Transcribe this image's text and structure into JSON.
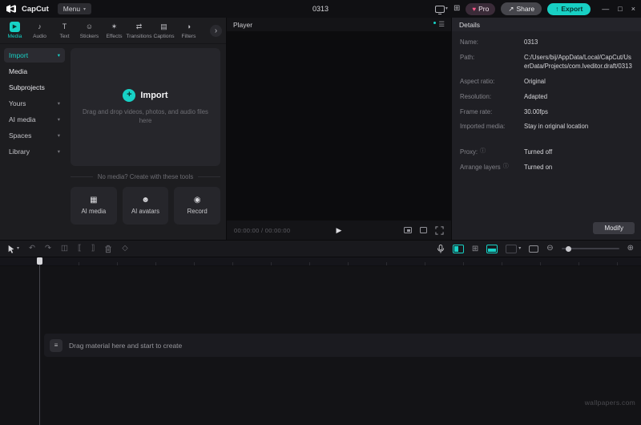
{
  "colors": {
    "accent": "#17d1c5",
    "pro_heart": "#ff5a8c",
    "export_bg": "#18d0c4"
  },
  "titlebar": {
    "app_name": "CapCut",
    "menu_label": "Menu",
    "document_title": "0313",
    "pro_label": "Pro",
    "share_label": "Share",
    "export_label": "Export"
  },
  "icons": {
    "caret_down": "▾",
    "chevron_more": "›",
    "minimize": "—",
    "maximize": "□",
    "close": "×",
    "share_arrow": "↗",
    "export_arrow": "↑",
    "heart": "♥",
    "layout_grid": "⊞",
    "tab_media": "▶",
    "tab_audio": "♪",
    "tab_text": "T",
    "tab_stickers": "☺",
    "tab_effects": "✶",
    "tab_transitions": "⇄",
    "tab_captions": "▤",
    "tab_filters": "◑",
    "plus": "+",
    "tool_ai_media": "▦",
    "tool_ai_avatars": "☻",
    "tool_record": "◉",
    "player_menu": "☰",
    "play": "▶",
    "undo": "↶",
    "redo": "↷",
    "split": "◫",
    "trim_left": "⟦",
    "trim_right": "⟧",
    "keyframe": "◇",
    "zoom_out": "⊖",
    "zoom_in": "⊕",
    "info": "ⓘ",
    "track_lines": "≡"
  },
  "media_panel": {
    "tabs": [
      {
        "label": "Media"
      },
      {
        "label": "Audio"
      },
      {
        "label": "Text"
      },
      {
        "label": "Stickers"
      },
      {
        "label": "Effects"
      },
      {
        "label": "Transitions"
      },
      {
        "label": "Captions"
      },
      {
        "label": "Filters"
      }
    ],
    "sidebar": [
      {
        "label": "Import"
      },
      {
        "label": "Media"
      },
      {
        "label": "Subprojects"
      },
      {
        "label": "Yours"
      },
      {
        "label": "AI media"
      },
      {
        "label": "Spaces"
      },
      {
        "label": "Library"
      }
    ],
    "import_zone": {
      "button_label": "Import",
      "hint": "Drag and drop videos, photos, and audio files here"
    },
    "tools_header": "No media? Create with these tools",
    "tools": [
      {
        "label": "AI media"
      },
      {
        "label": "AI avatars"
      },
      {
        "label": "Record"
      }
    ]
  },
  "player": {
    "title": "Player",
    "time": "00:00:00 / 00:00:00"
  },
  "details": {
    "title": "Details",
    "rows": [
      {
        "label": "Name:",
        "value": "0313"
      },
      {
        "label": "Path:",
        "value": "C:/Users/bij/AppData/Local/CapCut/UserData/Projects/com.lveditor.draft/0313"
      },
      {
        "label": "Aspect ratio:",
        "value": "Original"
      },
      {
        "label": "Resolution:",
        "value": "Adapted"
      },
      {
        "label": "Frame rate:",
        "value": "30.00fps"
      },
      {
        "label": "Imported media:",
        "value": "Stay in original location"
      },
      {
        "label": "Proxy:",
        "value": "Turned off"
      },
      {
        "label": "Arrange layers",
        "value": "Turned on"
      }
    ],
    "modify_label": "Modify"
  },
  "timeline": {
    "empty_hint": "Drag material here and start to create"
  },
  "watermark": "wallpapers.com"
}
